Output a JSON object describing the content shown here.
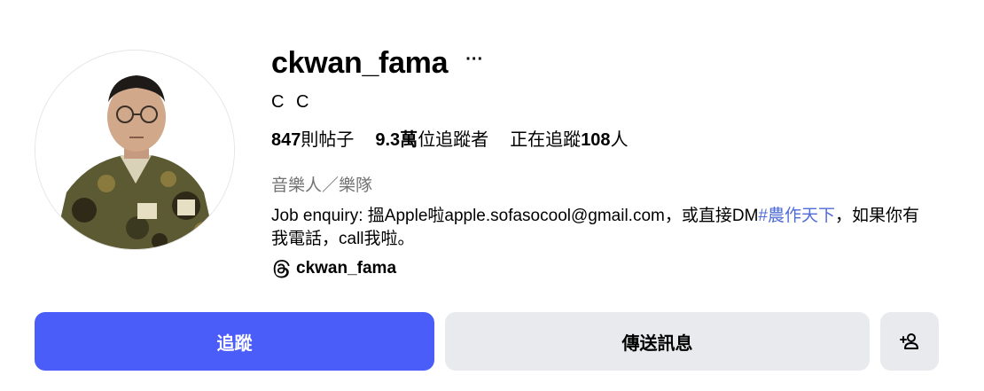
{
  "profile": {
    "username": "ckwan_fama",
    "more_label": "···",
    "full_name": "C C",
    "stats": {
      "posts_count": "847",
      "posts_label": "則帖子",
      "followers_count": "9.3萬",
      "followers_label": "位追蹤者",
      "following_prefix": "正在追蹤",
      "following_count": "108",
      "following_suffix": "人"
    },
    "category": "音樂人／樂隊",
    "bio": {
      "text_before": "Job enquiry: 搵Apple啦apple.sofasocool@gmail.com，或直接DM",
      "hashtag": "#農作天下",
      "text_after": "，如果你有我電話，call我啦。"
    },
    "threads_handle": "ckwan_fama"
  },
  "actions": {
    "follow_label": "追蹤",
    "message_label": "傳送訊息"
  },
  "icons": {
    "more": "more-options-icon",
    "threads": "threads-icon",
    "suggest": "add-person-icon"
  },
  "colors": {
    "primary": "#4a5df9",
    "secondary_button": "#e8eaed",
    "hashtag": "#4f6bd8",
    "muted_text": "#737373"
  }
}
